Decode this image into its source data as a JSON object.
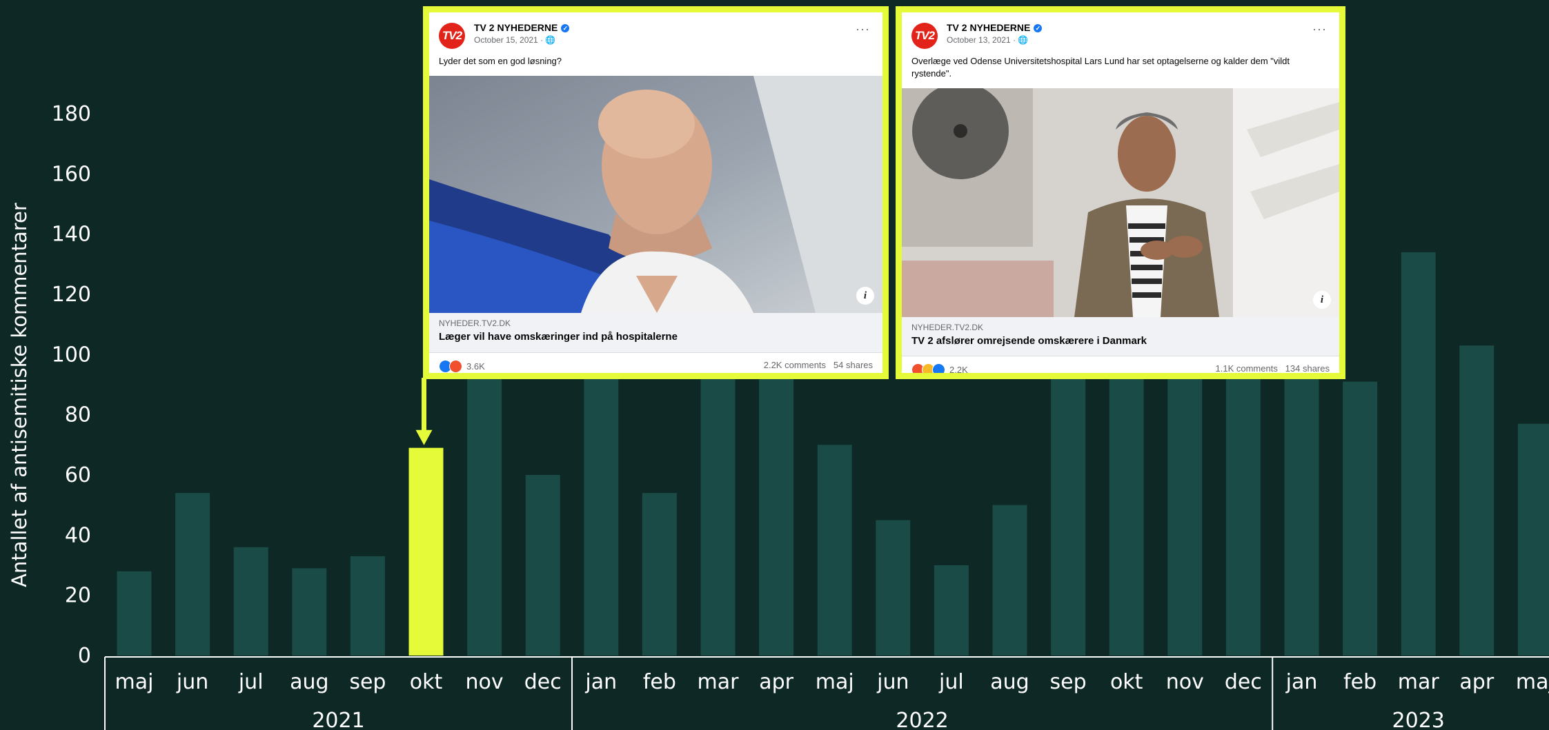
{
  "chart_data": {
    "type": "bar",
    "ylabel": "Antallet af antisemitiske kommentarer",
    "xlabel": "",
    "ylim": [
      0,
      180
    ],
    "yticks": [
      0,
      20,
      40,
      60,
      80,
      100,
      120,
      140,
      160,
      180
    ],
    "categories": [
      "maj",
      "jun",
      "jul",
      "aug",
      "sep",
      "okt",
      "nov",
      "dec",
      "jan",
      "feb",
      "mar",
      "apr",
      "maj",
      "jun",
      "jul",
      "aug",
      "sep",
      "okt",
      "nov",
      "dec",
      "jan",
      "feb",
      "mar",
      "apr",
      "maj"
    ],
    "values": [
      28,
      54,
      36,
      29,
      33,
      69,
      100,
      60,
      100,
      54,
      100,
      100,
      70,
      45,
      30,
      50,
      100,
      100,
      100,
      100,
      100,
      91,
      134,
      103,
      77
    ],
    "highlight_index": 5,
    "year_groups": [
      {
        "label": "2021",
        "start": 0,
        "end": 7
      },
      {
        "label": "2022",
        "start": 8,
        "end": 19
      },
      {
        "label": "2023",
        "start": 20,
        "end": 24
      }
    ],
    "colors": {
      "bar": "#1a4b46",
      "highlight": "#e5fb3a",
      "background": "#0d2825",
      "axis": "#ffffff"
    }
  },
  "posts": [
    {
      "page_name": "TV 2 NYHEDERNE",
      "logo_text": "TV2",
      "date": "October 15, 2021 · ",
      "text": "Lyder det som en god løsning?",
      "domain": "NYHEDER.TV2.DK",
      "headline": "Læger vil have omskæringer ind på hospitalerne",
      "reaction_count": "3.6K",
      "comments": "2.2K comments",
      "shares": "54 shares",
      "more": "···"
    },
    {
      "page_name": "TV 2 NYHEDERNE",
      "logo_text": "TV2",
      "date": "October 13, 2021 · ",
      "text": "Overlæge ved Odense Universitetshospital Lars Lund har set optagelserne og kalder dem \"vildt rystende\".",
      "domain": "NYHEDER.TV2.DK",
      "headline": "TV 2 afslører omrejsende omskærere i Danmark",
      "reaction_count": "2.2K",
      "comments": "1.1K comments",
      "shares": "134 shares",
      "more": "···"
    }
  ]
}
